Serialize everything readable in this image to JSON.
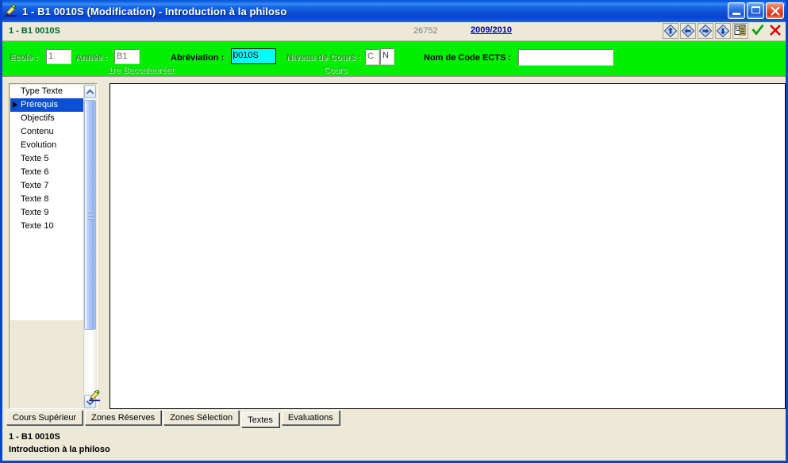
{
  "window": {
    "title": "1 - B1    0010S (Modification) - Introduction à la philoso",
    "app_icon": "pen-writing-icon",
    "minimize_label": "Minimize",
    "maximize_label": "Maximize",
    "close_label": "Close"
  },
  "record_bar": {
    "code": "1 - B1    0010S",
    "number": "26752",
    "academic_year": "2009/2010",
    "nav": {
      "first_label": "First record",
      "previous_label": "Previous record",
      "next_label": "Next record",
      "last_label": "Last record",
      "form_label": "Record details",
      "validate_label": "Validate",
      "cancel_label": "Cancel"
    }
  },
  "form": {
    "accent_color": "#00ef00",
    "fields": [
      {
        "label": "Ecole :",
        "value": "1",
        "sub": ""
      },
      {
        "label": "Année :",
        "value": "B1",
        "sub": "1re Baccalauréat"
      },
      {
        "label": "Abréviation :",
        "value": "0010S",
        "sub": ""
      },
      {
        "label": "Niveau de Cours :",
        "value": "C",
        "value2": "N",
        "sub": "Cours"
      },
      {
        "label": "Nom de Code ECTS :",
        "value": "",
        "sub": ""
      }
    ]
  },
  "list_panel": {
    "header": "Type Texte",
    "items": [
      "Prérequis",
      "Objectifs",
      "Contenu",
      "Evolution",
      "Texte 5",
      "Texte 6",
      "Texte 7",
      "Texte 8",
      "Texte 9",
      "Texte 10"
    ],
    "selected_index": 0,
    "edit_icon": "pen-writing-icon"
  },
  "editor": {
    "content": ""
  },
  "tabs": [
    {
      "label": "Cours Supérieur",
      "active": false
    },
    {
      "label": "Zones Réserves",
      "active": false
    },
    {
      "label": "Zones Sélection",
      "active": false
    },
    {
      "label": "Textes",
      "active": true
    },
    {
      "label": "Evaluations",
      "active": false
    }
  ],
  "status": {
    "line1": "1 - B1    0010S",
    "line2": "Introduction à la philoso"
  }
}
